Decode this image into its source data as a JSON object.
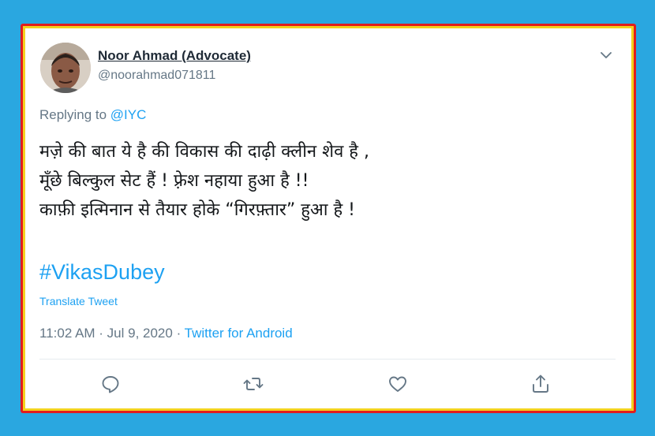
{
  "tweet": {
    "author_name": "Noor Ahmad (Advocate)",
    "handle": "@noorahmad071811",
    "reply_prefix": "Replying to",
    "reply_mention": "@IYC",
    "lines": [
      "मज़े की बात ये है की विकास की दाढ़ी क्लीन शेव है ,",
      "मूँछे बिल्कुल सेट हैं ! फ़्रेश नहाया हुआ है !!",
      "काफ़ी इत्मिनान से तैयार होके “गिरफ़्तार” हुआ है !"
    ],
    "hashtag": "#VikasDubey",
    "translate_label": "Translate Tweet",
    "timestamp": "11:02 AM · Jul 9, 2020 · ",
    "source": "Twitter for Android"
  },
  "colors": {
    "background": "#2aa7e0",
    "frame_outer": "#e21d1d",
    "frame_inner": "#f4d21e",
    "link": "#1da1f2",
    "muted": "#657786"
  },
  "icons": [
    "chevron-down-icon",
    "reply-icon",
    "retweet-icon",
    "like-icon",
    "share-icon"
  ]
}
